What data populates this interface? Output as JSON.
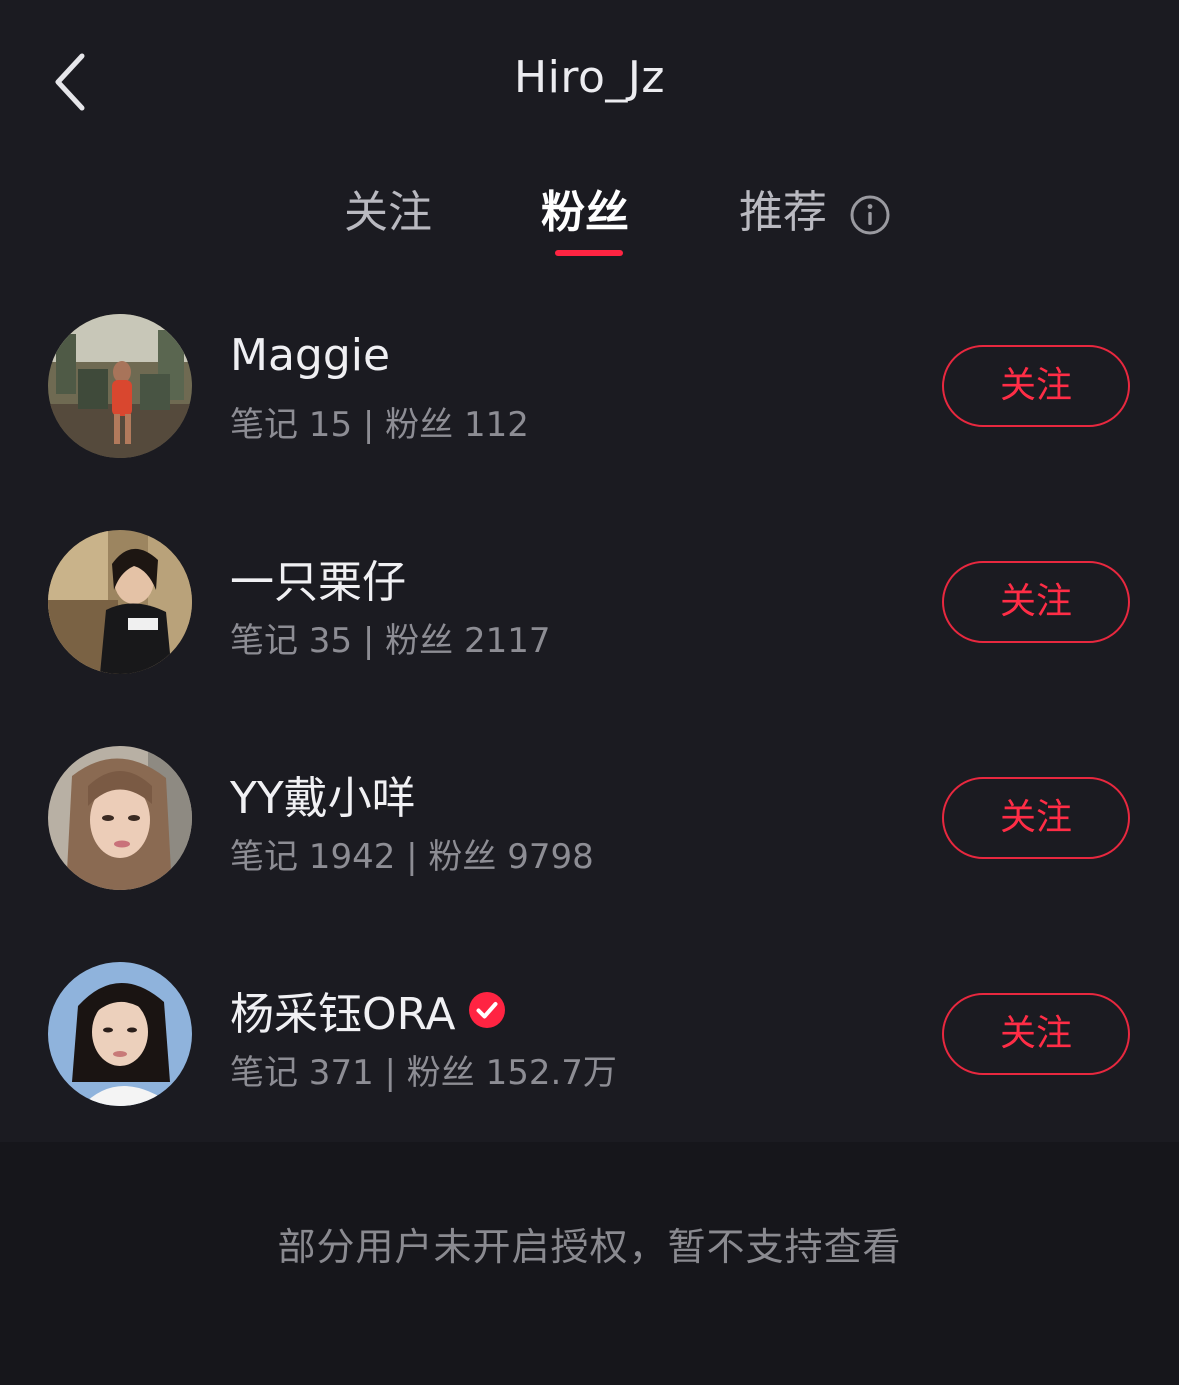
{
  "header": {
    "title": "Hiro_Jz"
  },
  "icons": {
    "back": "chevron-left-icon",
    "info": "info-circle-icon",
    "verified": "verified-badge-icon"
  },
  "tabs": [
    {
      "label": "关注",
      "active": false
    },
    {
      "label": "粉丝",
      "active": true
    },
    {
      "label": "推荐",
      "active": false
    }
  ],
  "users": [
    {
      "name": "Maggie",
      "stats": "笔记 15 | 粉丝 112",
      "button": "关注",
      "verified": false
    },
    {
      "name": "一只栗仔",
      "stats": "笔记 35 | 粉丝 2117",
      "button": "关注",
      "verified": false
    },
    {
      "name": "YY戴小咩",
      "stats": "笔记 1942 | 粉丝 9798",
      "button": "关注",
      "verified": false
    },
    {
      "name": "杨采钰ORA",
      "stats": "笔记 371 | 粉丝 152.7万",
      "button": "关注",
      "verified": true
    }
  ],
  "footer": {
    "note": "部分用户未开启授权，暂不支持查看"
  },
  "colors": {
    "accent": "#ff2442",
    "background": "#1b1b21",
    "footer": "#16161b"
  }
}
